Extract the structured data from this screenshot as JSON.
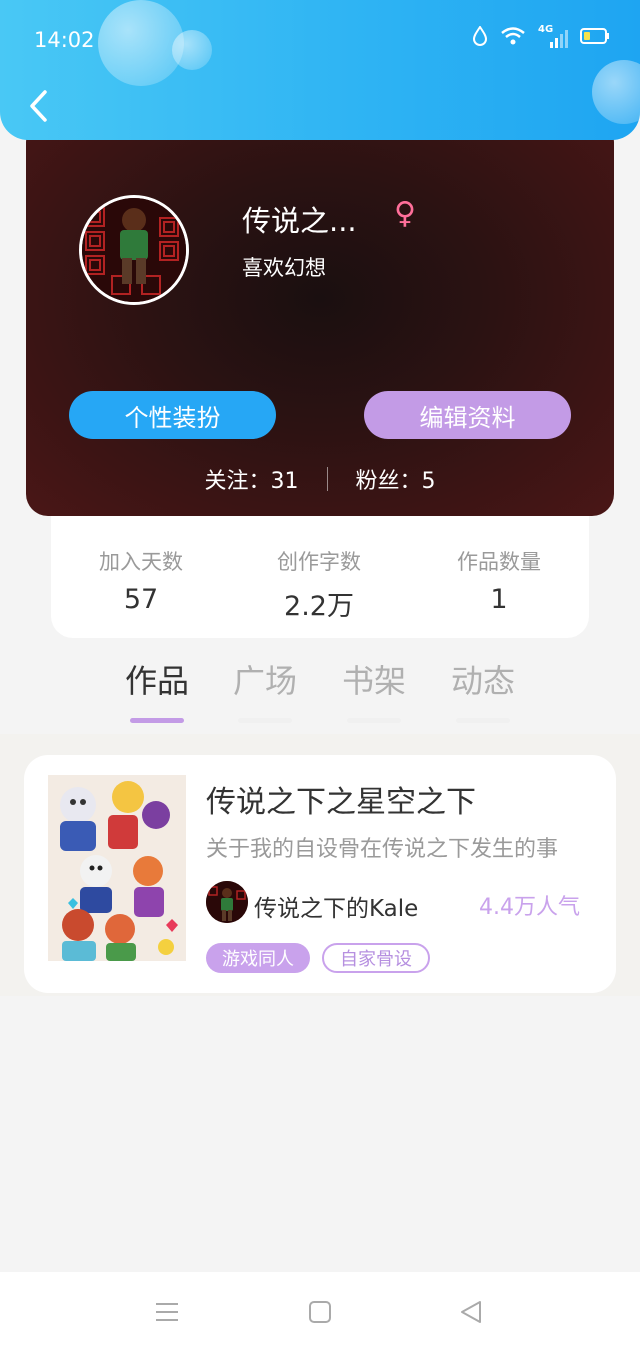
{
  "status_bar": {
    "time": "14:02",
    "network": "4G"
  },
  "profile": {
    "nickname": "传说之...",
    "gender_symbol": "♀",
    "signature": "喜欢幻想",
    "dress_up_button": "个性装扮",
    "edit_profile_button": "编辑资料",
    "following": "关注：31",
    "followers": "粉丝：5"
  },
  "stats": [
    {
      "label": "加入天数",
      "value": "57"
    },
    {
      "label": "创作字数",
      "value": "2.2万"
    },
    {
      "label": "作品数量",
      "value": "1"
    }
  ],
  "tabs": [
    {
      "label": "作品",
      "active": true
    },
    {
      "label": "广场",
      "active": false
    },
    {
      "label": "书架",
      "active": false
    },
    {
      "label": "动态",
      "active": false
    }
  ],
  "works": [
    {
      "title": "传说之下之星空之下",
      "description": "关于我的自设骨在传说之下发生的事",
      "author": "传说之下的Kale",
      "popularity": "4.4万人气",
      "tags": [
        "游戏同人",
        "自家骨设"
      ]
    }
  ],
  "colors": {
    "header_blue": "#2fb4f3",
    "accent_purple": "#c39be6",
    "button_blue": "#26a7f5",
    "gender_pink": "#ff6f9a"
  }
}
